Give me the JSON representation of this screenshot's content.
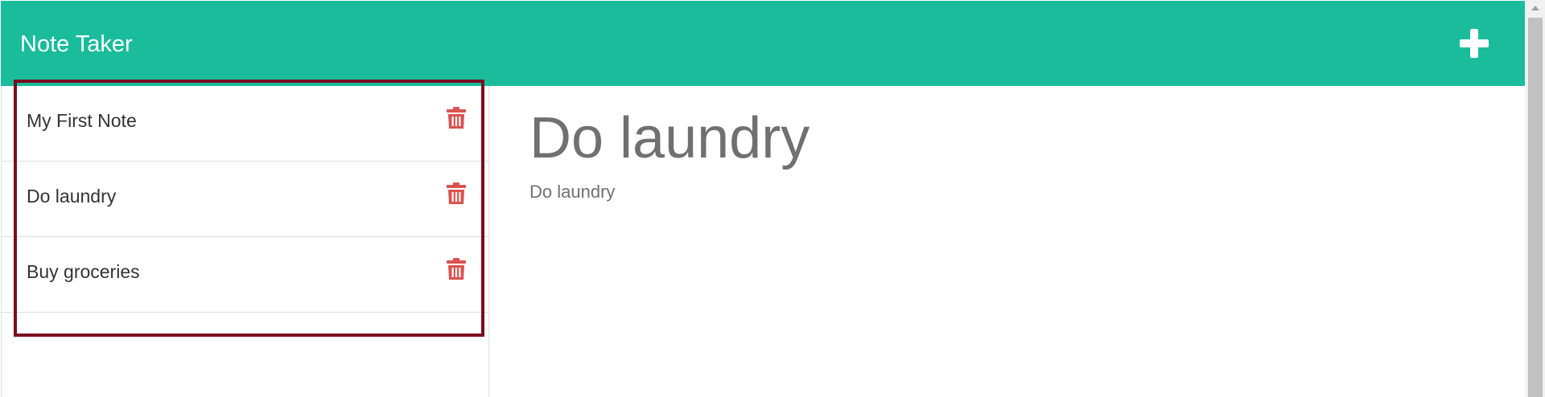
{
  "app": {
    "title": "Note Taker"
  },
  "colors": {
    "navbar": "#1abc9c",
    "delete_icon": "#d9534f",
    "highlight_border": "#7b0c1e",
    "heading_text": "#707070"
  },
  "header": {
    "add_icon": "plus-icon"
  },
  "sidebar": {
    "notes": [
      {
        "title": "My First Note",
        "icon": "trash-icon"
      },
      {
        "title": "Do laundry",
        "icon": "trash-icon"
      },
      {
        "title": "Buy groceries",
        "icon": "trash-icon"
      }
    ]
  },
  "main": {
    "note_title": "Do laundry",
    "note_text": "Do laundry"
  }
}
